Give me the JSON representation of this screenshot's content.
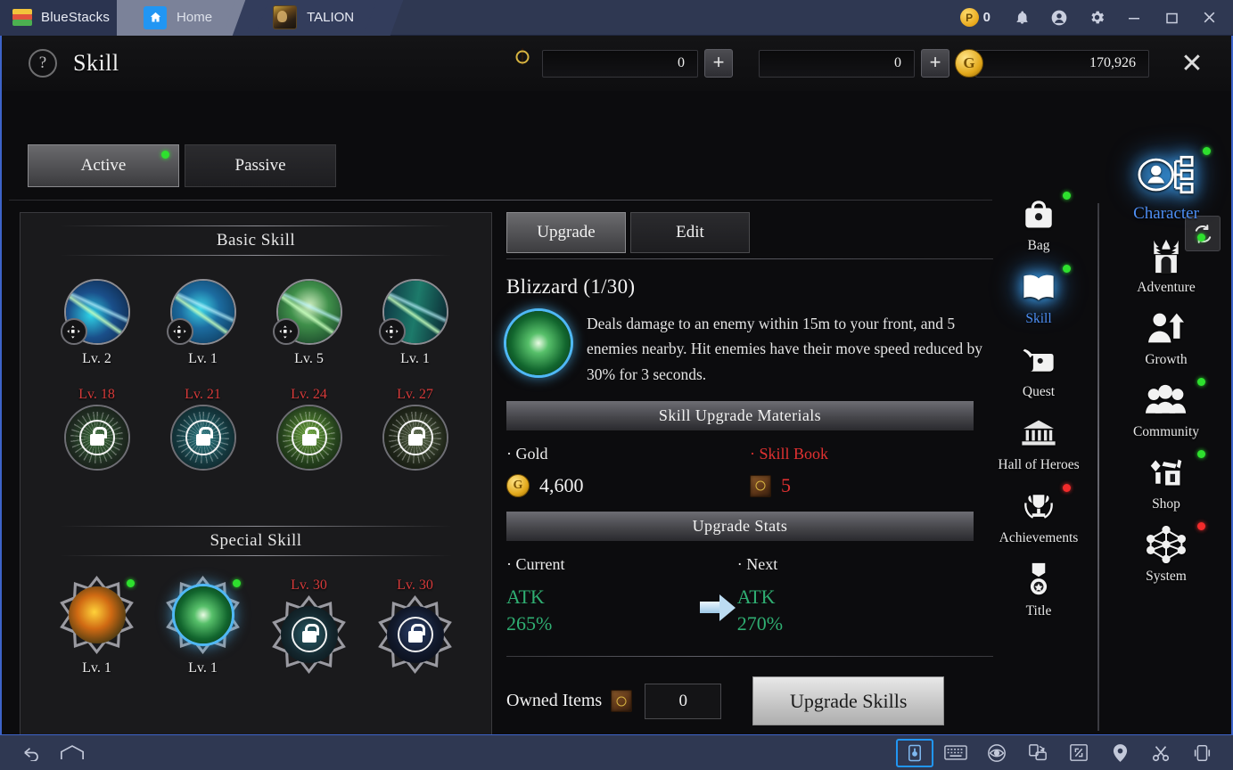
{
  "titlebar": {
    "brand": "BlueStacks",
    "brand_logo_icon": "bluestacks-logo-icon",
    "tabs": [
      {
        "label": "Home",
        "icon": "home-icon"
      },
      {
        "label": "TALION",
        "icon": "talion-app-icon"
      }
    ],
    "points": {
      "icon": "points-coin-icon",
      "value": "0"
    },
    "sys_icons": [
      "notification-bell-icon",
      "user-account-icon",
      "settings-gear-icon",
      "minimize-icon",
      "maximize-icon",
      "close-icon"
    ]
  },
  "header": {
    "help_icon": "help-question-icon",
    "title": "Skill",
    "currencies": [
      {
        "name": "skill-book",
        "icon": "skill-book-icon",
        "value": "0",
        "add_label": "+"
      },
      {
        "name": "diamond",
        "icon": "diamond-icon",
        "value": "0",
        "add_label": "+"
      },
      {
        "name": "gold",
        "icon": "gold-coin-icon",
        "value": "170,926"
      }
    ],
    "close_label": "✕"
  },
  "mode_tabs": [
    {
      "label": "Active",
      "selected": true,
      "badge": "green"
    },
    {
      "label": "Passive",
      "selected": false,
      "badge": null
    }
  ],
  "skill_panel": {
    "refresh_icon": "refresh-icon",
    "sections": [
      {
        "title": "Basic Skill",
        "rows": [
          {
            "skills": [
              {
                "level_label": "Lv. 2",
                "locked": false,
                "art": "art-a",
                "badge": "dpad"
              },
              {
                "level_label": "Lv. 1",
                "locked": false,
                "art": "art-b",
                "badge": "dpad"
              },
              {
                "level_label": "Lv. 5",
                "locked": false,
                "art": "art-c",
                "badge": "dpad"
              },
              {
                "level_label": "Lv. 1",
                "locked": false,
                "art": "art-d",
                "badge": "dpad"
              }
            ]
          },
          {
            "skills": [
              {
                "req_label": "Lv. 18",
                "locked": true,
                "art": "art-l1"
              },
              {
                "req_label": "Lv. 21",
                "locked": true,
                "art": "art-l2"
              },
              {
                "req_label": "Lv. 24",
                "locked": true,
                "art": "art-l3"
              },
              {
                "req_label": "Lv. 27",
                "locked": true,
                "art": "art-l4"
              }
            ]
          }
        ]
      },
      {
        "title": "Special Skill",
        "rows": [
          {
            "skills": [
              {
                "level_label": "Lv. 1",
                "locked": false,
                "art": "art-fire",
                "selected": false,
                "dot": "green"
              },
              {
                "level_label": "Lv. 1",
                "locked": false,
                "art": "art-bliz",
                "selected": true,
                "dot": "green"
              },
              {
                "req_label": "Lv. 30",
                "locked": true,
                "art": "art-ls1"
              },
              {
                "req_label": "Lv. 30",
                "locked": true,
                "art": "art-ls2"
              }
            ]
          }
        ]
      }
    ]
  },
  "detail": {
    "tabs": [
      {
        "label": "Upgrade",
        "selected": true
      },
      {
        "label": "Edit",
        "selected": false
      }
    ],
    "skill_name": "Blizzard (1/30)",
    "skill_icon": "blizzard-skill-icon",
    "skill_description": "Deals damage to an enemy within 15m to your front, and 5 enemies nearby. Hit enemies have their move speed reduced by 30% for 3 seconds.",
    "materials": {
      "band_title": "Skill Upgrade Materials",
      "items": [
        {
          "label": "· Gold",
          "value": "4,600",
          "icon": "gold-coin-icon",
          "insufficient": false
        },
        {
          "label": "· Skill Book",
          "value": "5",
          "icon": "skill-book-icon",
          "insufficient": true
        }
      ]
    },
    "upgrade_stats": {
      "band_title": "Upgrade Stats",
      "current": {
        "label": "· Current",
        "stat": "ATK",
        "value": "265%"
      },
      "next": {
        "label": "· Next",
        "stat": "ATK",
        "value": "270%"
      },
      "arrow_icon": "arrow-right-icon"
    },
    "owned": {
      "label": "Owned Items",
      "icon": "skill-book-icon",
      "value": "0"
    },
    "upgrade_button": "Upgrade Skills"
  },
  "nav_rail_left": [
    {
      "label": "Bag",
      "icon": "bag-icon",
      "badge": "green",
      "active": false
    },
    {
      "label": "Skill",
      "icon": "book-icon",
      "badge": "green",
      "active": true
    },
    {
      "label": "Quest",
      "icon": "scroll-quill-icon",
      "badge": null,
      "active": false
    },
    {
      "label": "Hall of Heroes",
      "icon": "temple-icon",
      "badge": null,
      "active": false
    },
    {
      "label": "Achievements",
      "icon": "trophy-wreath-icon",
      "badge": "red",
      "active": false
    },
    {
      "label": "Title",
      "icon": "medal-icon",
      "badge": null,
      "active": false
    }
  ],
  "nav_rail_right": [
    {
      "label": "Character",
      "icon": "character-icon",
      "badge": "green",
      "active": true
    },
    {
      "label": "Adventure",
      "icon": "gate-icon",
      "badge": "green",
      "active": false
    },
    {
      "label": "Growth",
      "icon": "growth-arrow-icon",
      "badge": null,
      "active": false
    },
    {
      "label": "Community",
      "icon": "people-group-icon",
      "badge": "green",
      "active": false
    },
    {
      "label": "Shop",
      "icon": "shop-cart-icon",
      "badge": "green",
      "active": false
    },
    {
      "label": "System",
      "icon": "network-nodes-icon",
      "badge": "red",
      "active": false
    }
  ],
  "bottom_toolbar": {
    "left": [
      "back-arrow-icon",
      "home-outline-icon"
    ],
    "right": [
      "tap-point-icon",
      "keyboard-icon",
      "eye-icon",
      "rotate-icon",
      "fullscreen-icon",
      "location-pin-icon",
      "scissors-icon",
      "shake-icon"
    ]
  },
  "colors": {
    "accent_blue": "#3d63c8",
    "selected_blue": "#4f8ff5",
    "green_badge": "#2ee02e",
    "red_badge": "#f22b2b",
    "red_text": "#e03131",
    "stat_green": "#2fae72",
    "bluestacks_bar": "#2f3852"
  }
}
